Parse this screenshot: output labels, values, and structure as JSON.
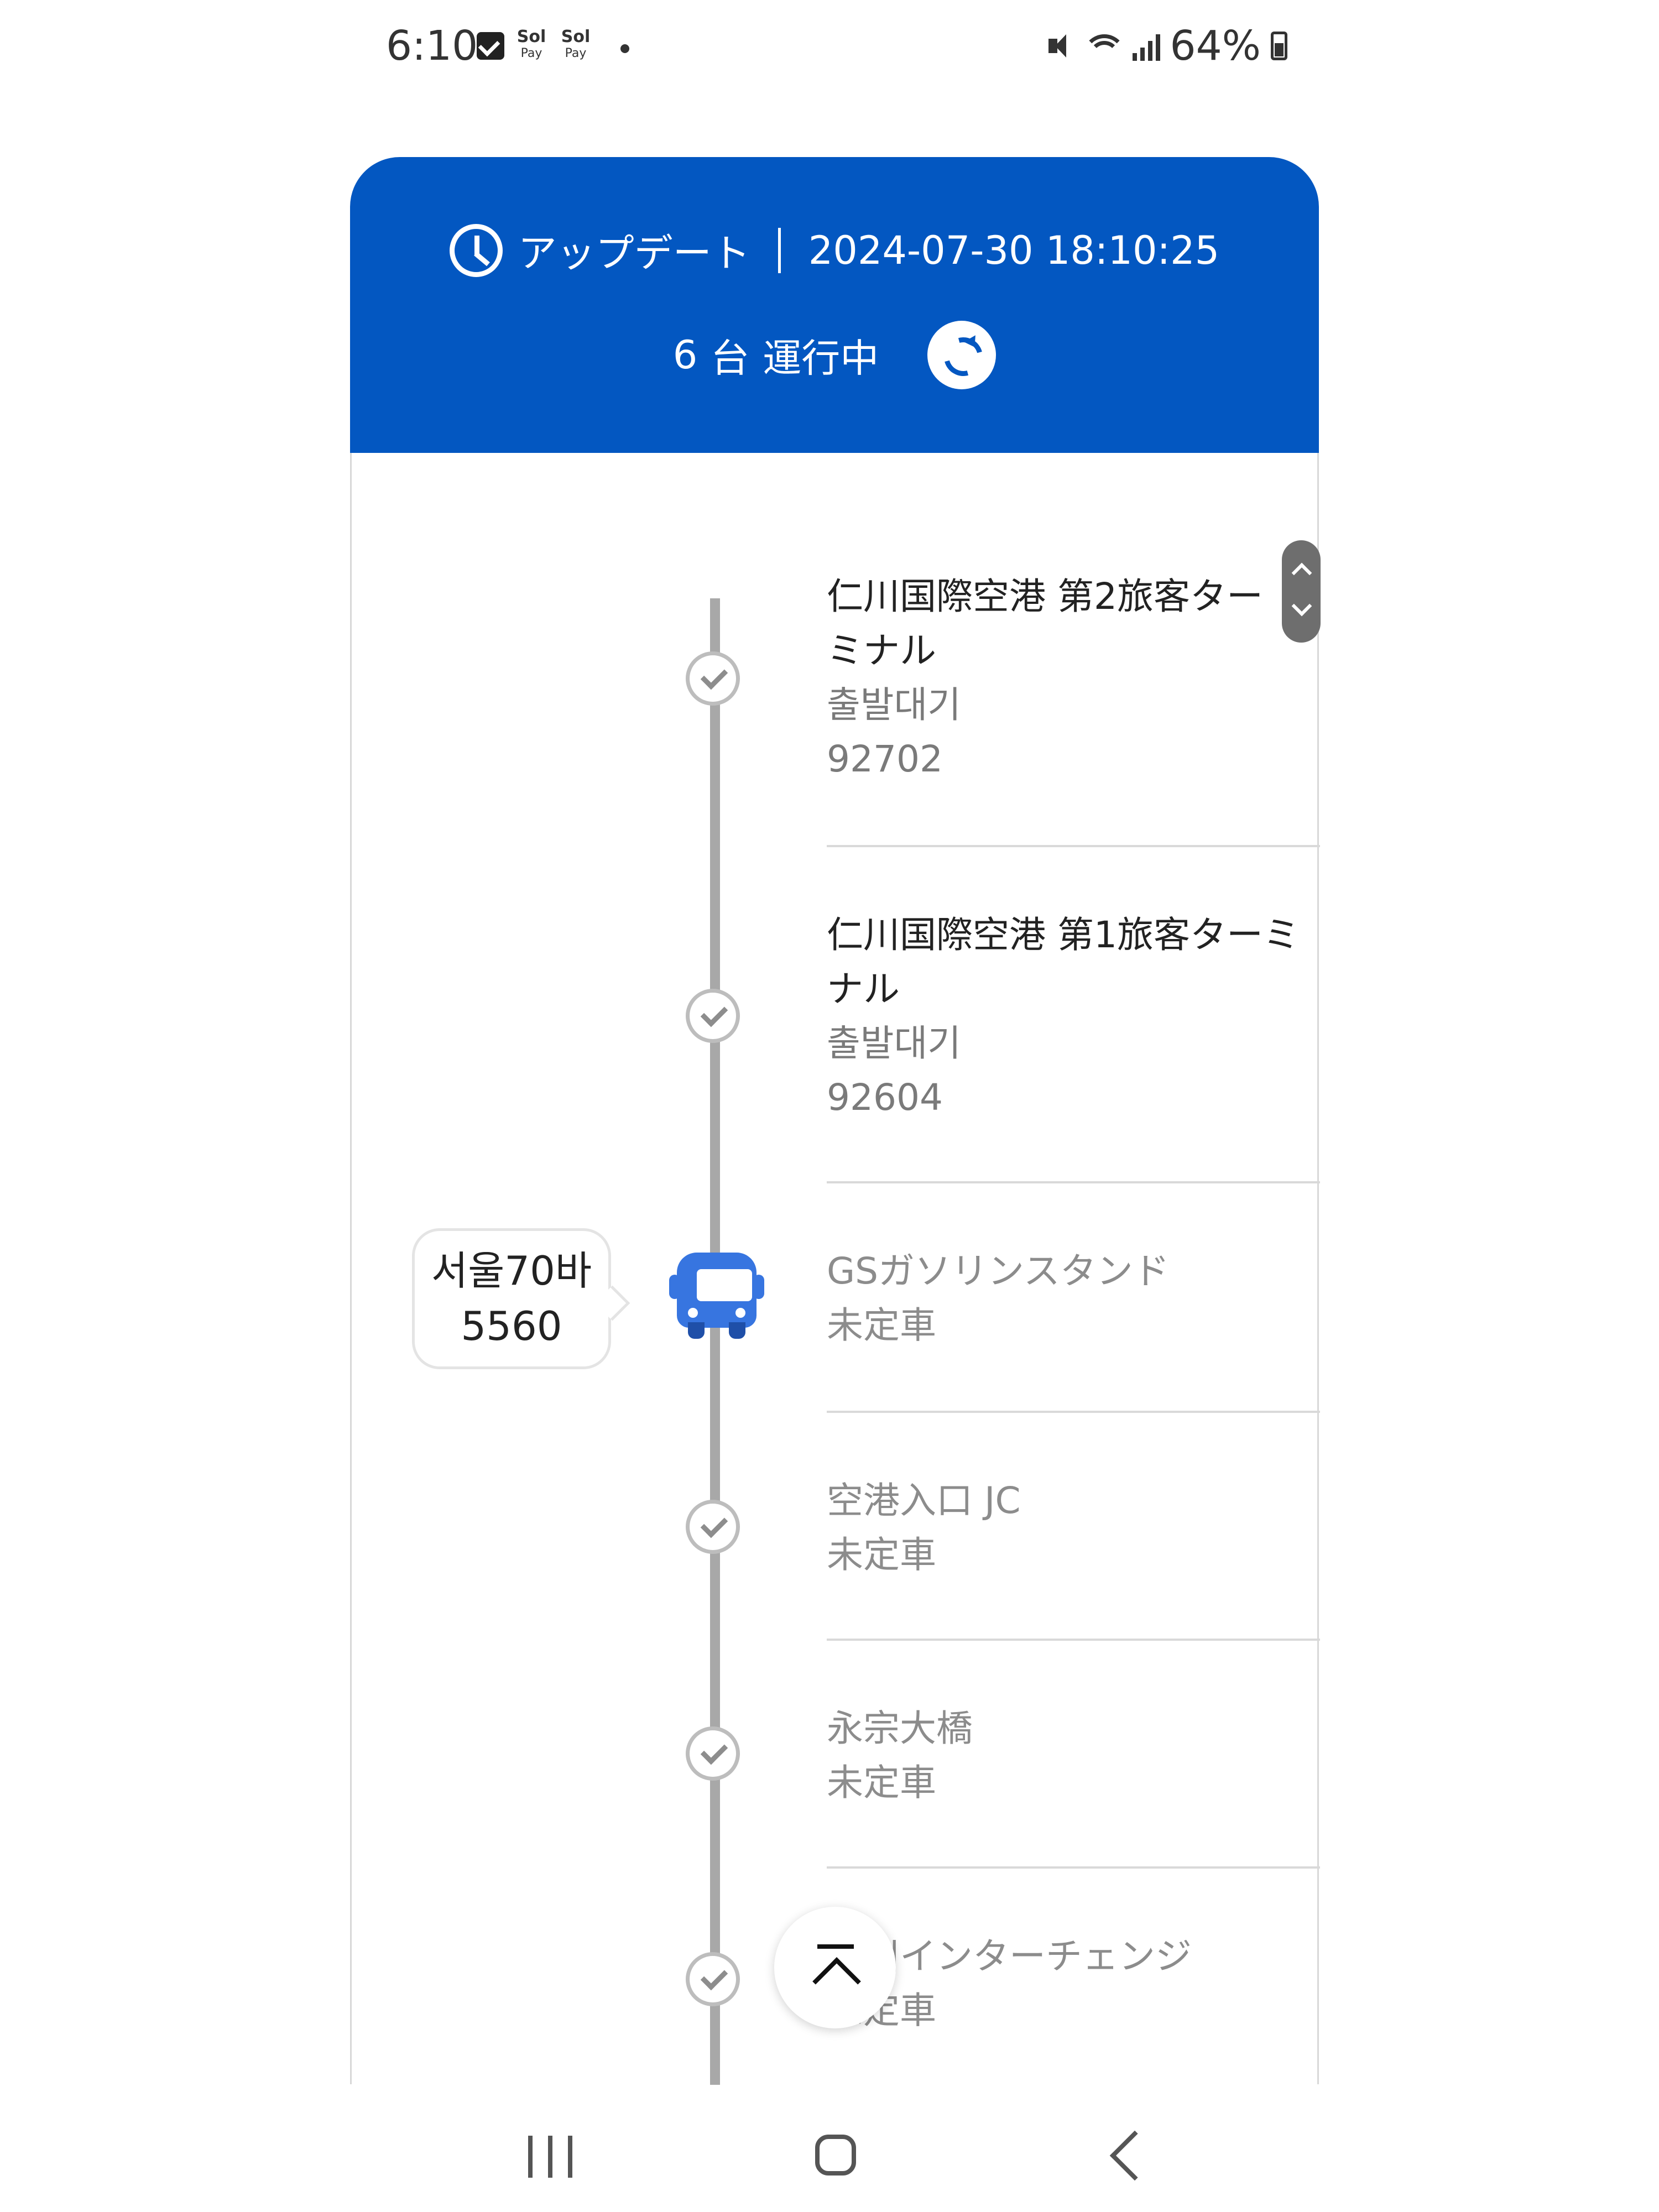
{
  "status_bar": {
    "time": "6:10",
    "pay_label_1": "Sol",
    "pay_sub_1": "Pay",
    "pay_label_2": "Sol",
    "pay_sub_2": "Pay",
    "battery": "64%"
  },
  "header": {
    "update_label": "アップデート",
    "timestamp": "2024-07-30 18:10:25",
    "count_number": "6",
    "count_unit": "台",
    "running_label": "運行中"
  },
  "stops": [
    {
      "name": "仁川国際空港 第2旅客ターミナル",
      "status": "출발대기",
      "number": "92702"
    },
    {
      "name": "仁川国際空港 第1旅客ターミナル",
      "status": "출발대기",
      "number": "92604"
    },
    {
      "name": "GSガソリンスタンド",
      "status": "未定車"
    },
    {
      "name": "空港入口 JC",
      "status": "未定車"
    },
    {
      "name": "永宗大橋",
      "status": "未定車"
    },
    {
      "name": "仁川インターチェンジ",
      "status": "未定車"
    }
  ],
  "bus": {
    "plate_line1": "서울70바",
    "plate_line2": "5560",
    "color": "#3775E0"
  },
  "colors": {
    "header_bg": "#0357C1",
    "timeline": "#A8A8A8"
  }
}
